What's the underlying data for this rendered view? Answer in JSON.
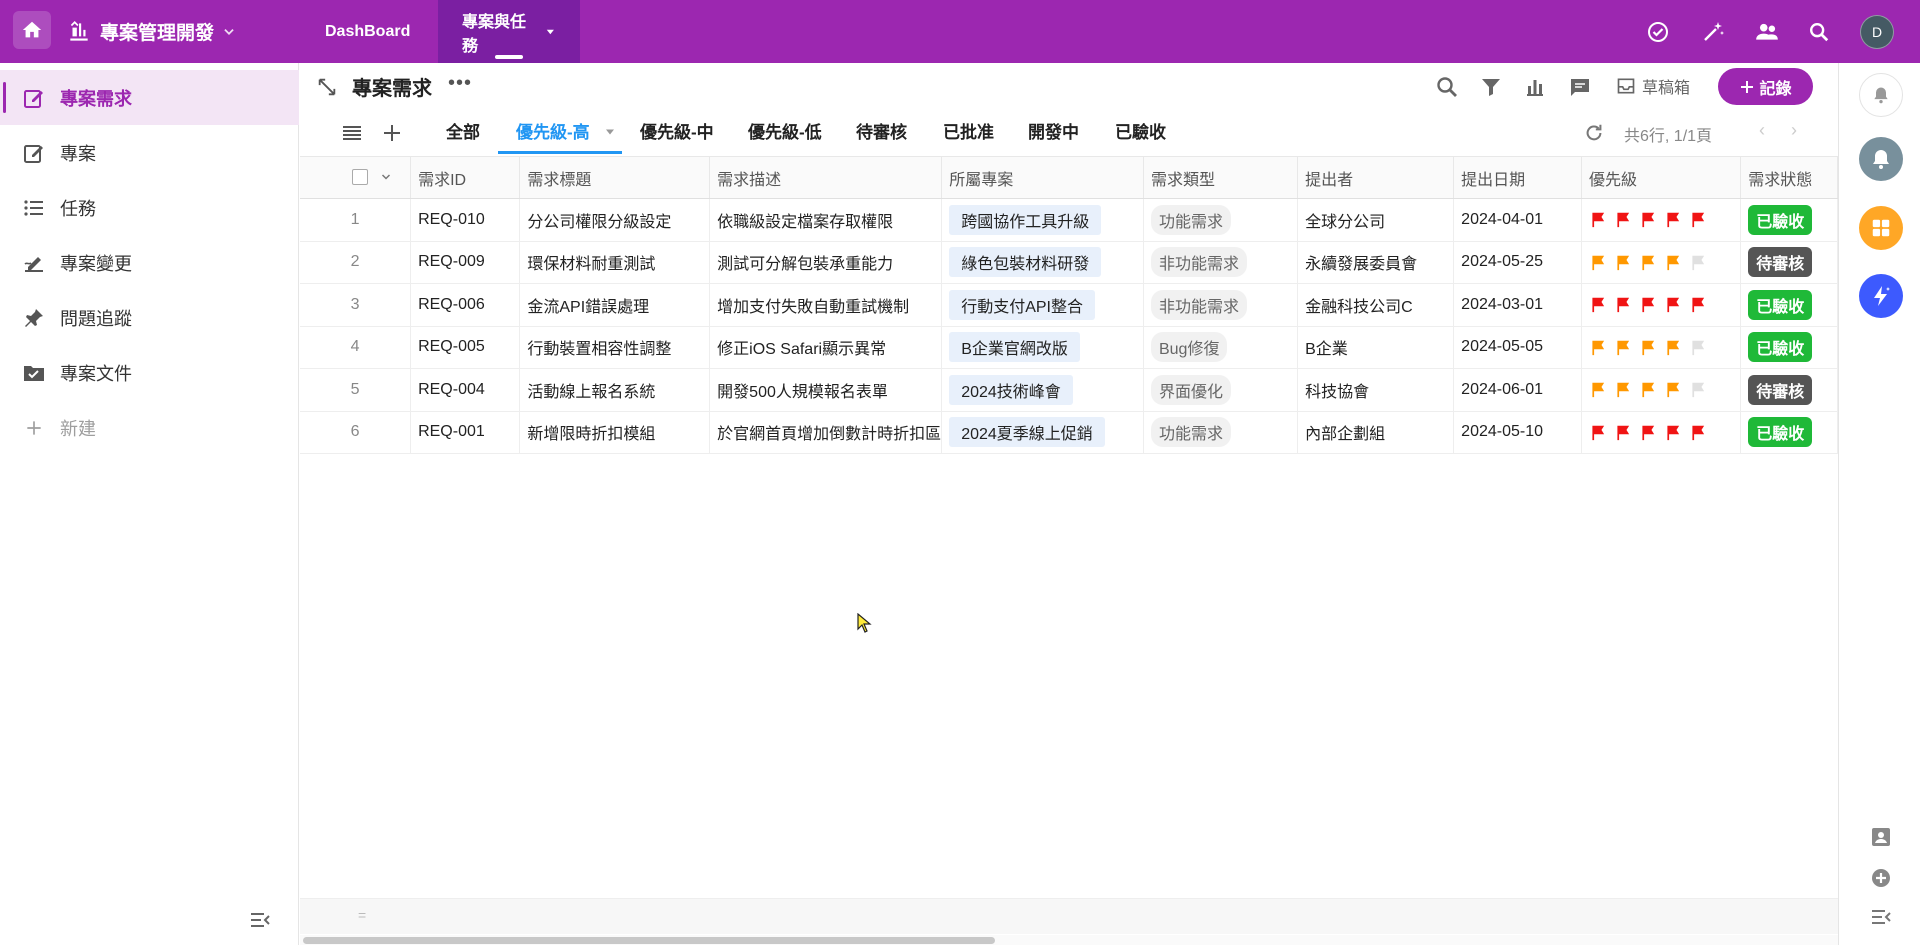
{
  "topbar": {
    "app_title": "專案管理開發",
    "tabs": [
      {
        "label": "DashBoard",
        "active": false
      },
      {
        "label": "專案與任務",
        "active": true
      }
    ],
    "icons": [
      "home-icon",
      "app-icon",
      "chevron-down-icon",
      "task-check-icon",
      "magic-wand-icon",
      "people-icon",
      "search-icon"
    ],
    "avatar_letter": "D",
    "colors": {
      "brand": "#9c27b0",
      "active_tab": "#7b1fa2"
    }
  },
  "sidebar": {
    "items": [
      {
        "label": "專案需求",
        "icon": "edit-note-icon",
        "active": true
      },
      {
        "label": "專案",
        "icon": "edit-note-icon",
        "active": false
      },
      {
        "label": "任務",
        "icon": "list-icon",
        "active": false
      },
      {
        "label": "專案變更",
        "icon": "edit-sign-icon",
        "active": false
      },
      {
        "label": "問題追蹤",
        "icon": "pin-icon",
        "active": false
      },
      {
        "label": "專案文件",
        "icon": "checkbox-folder-icon",
        "active": false
      }
    ],
    "new_label": "新建"
  },
  "view": {
    "title": "專案需求",
    "more": "•••",
    "draft_label": "草稿箱",
    "record_button": "記錄",
    "tabs": [
      {
        "label": "全部",
        "active": false
      },
      {
        "label": "優先級-高",
        "active": true
      },
      {
        "label": "優先級-中",
        "active": false
      },
      {
        "label": "優先級-低",
        "active": false
      },
      {
        "label": "待審核",
        "active": false
      },
      {
        "label": "已批准",
        "active": false
      },
      {
        "label": "開發中",
        "active": false
      },
      {
        "label": "已驗收",
        "active": false
      }
    ],
    "page_info": "共6行, 1/1頁",
    "footer_mark": "="
  },
  "table": {
    "columns": [
      "需求ID",
      "需求標題",
      "需求描述",
      "所屬專案",
      "需求類型",
      "提出者",
      "提出日期",
      "優先級",
      "需求狀態"
    ],
    "rows": [
      {
        "num": "1",
        "id": "REQ-010",
        "title": "分公司權限分級設定",
        "desc": "依職級設定檔案存取權限",
        "project": "跨國協作工具升級",
        "type": "功能需求",
        "submitter": "全球分公司",
        "date": "2024-04-01",
        "priority": 5,
        "priority_color": "#f01414",
        "status": "已驗收",
        "status_kind": "done"
      },
      {
        "num": "2",
        "id": "REQ-009",
        "title": "環保材料耐重測試",
        "desc": "測試可分解包裝承重能力",
        "project": "綠色包裝材料研發",
        "type": "非功能需求",
        "submitter": "永續發展委員會",
        "date": "2024-05-25",
        "priority": 4,
        "priority_color": "#ff9800",
        "status": "待審核",
        "status_kind": "pending"
      },
      {
        "num": "3",
        "id": "REQ-006",
        "title": "金流API錯誤處理",
        "desc": "增加支付失敗自動重試機制",
        "project": "行動支付API整合",
        "type": "非功能需求",
        "submitter": "金融科技公司C",
        "date": "2024-03-01",
        "priority": 5,
        "priority_color": "#f01414",
        "status": "已驗收",
        "status_kind": "done"
      },
      {
        "num": "4",
        "id": "REQ-005",
        "title": "行動裝置相容性調整",
        "desc": "修正iOS Safari顯示異常",
        "project": "B企業官網改版",
        "type": "Bug修復",
        "submitter": "B企業",
        "date": "2024-05-05",
        "priority": 4,
        "priority_color": "#ff9800",
        "status": "已驗收",
        "status_kind": "done"
      },
      {
        "num": "5",
        "id": "REQ-004",
        "title": "活動線上報名系統",
        "desc": "開發500人規模報名表單",
        "project": "2024技術峰會",
        "type": "界面優化",
        "submitter": "科技協會",
        "date": "2024-06-01",
        "priority": 4,
        "priority_color": "#ff9800",
        "status": "待審核",
        "status_kind": "pending"
      },
      {
        "num": "6",
        "id": "REQ-001",
        "title": "新增限時折扣模組",
        "desc": "於官網首頁增加倒數計時折扣區",
        "project": "2024夏季線上促銷",
        "type": "功能需求",
        "submitter": "內部企劃組",
        "date": "2024-05-10",
        "priority": 5,
        "priority_color": "#f01414",
        "status": "已驗收",
        "status_kind": "done"
      }
    ]
  },
  "rightrail": {
    "icons": [
      "bell-icon",
      "notification-icon",
      "apps-grid-icon",
      "lightning-icon",
      "contact-icon",
      "add-circle-icon",
      "collapse-right-icon"
    ]
  }
}
